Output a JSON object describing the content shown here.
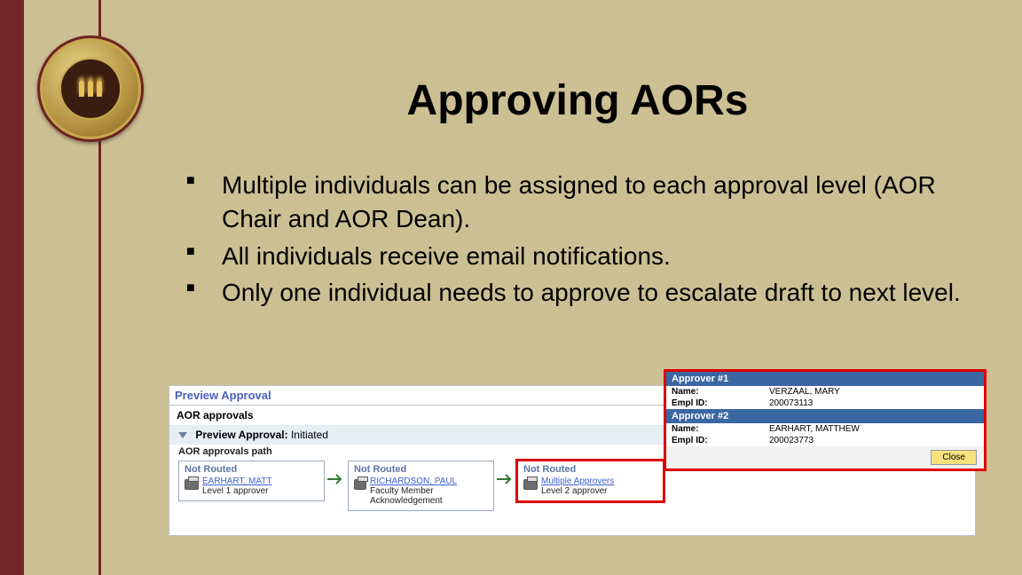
{
  "title": "Approving AORs",
  "bullets": [
    "Multiple individuals can be assigned to each approval level (AOR Chair and AOR Dean).",
    "All individuals receive email notifications.",
    "Only one individual needs to approve to escalate draft to next level."
  ],
  "preview": {
    "header": "Preview Approval",
    "sub": "AOR approvals",
    "status_label": "Preview Approval:",
    "status_value": "Initiated",
    "path_label": "AOR approvals path",
    "steps": [
      {
        "status": "Not Routed",
        "link": "EARHART, MATT",
        "role": "Level 1 approver"
      },
      {
        "status": "Not Routed",
        "link": "RICHARDSON, PAUL",
        "role": "Faculty Member Acknowledgement"
      },
      {
        "status": "Not Routed",
        "link": "Multiple Approvers",
        "role": "Level 2 approver"
      }
    ]
  },
  "popup": {
    "approvers": [
      {
        "header": "Approver #1",
        "name_label": "Name:",
        "name": "VERZAAL, MARY",
        "id_label": "Empl ID:",
        "id": "200073113"
      },
      {
        "header": "Approver #2",
        "name_label": "Name:",
        "name": "EARHART, MATTHEW",
        "id_label": "Empl ID:",
        "id": "200023773"
      }
    ],
    "close": "Close"
  }
}
